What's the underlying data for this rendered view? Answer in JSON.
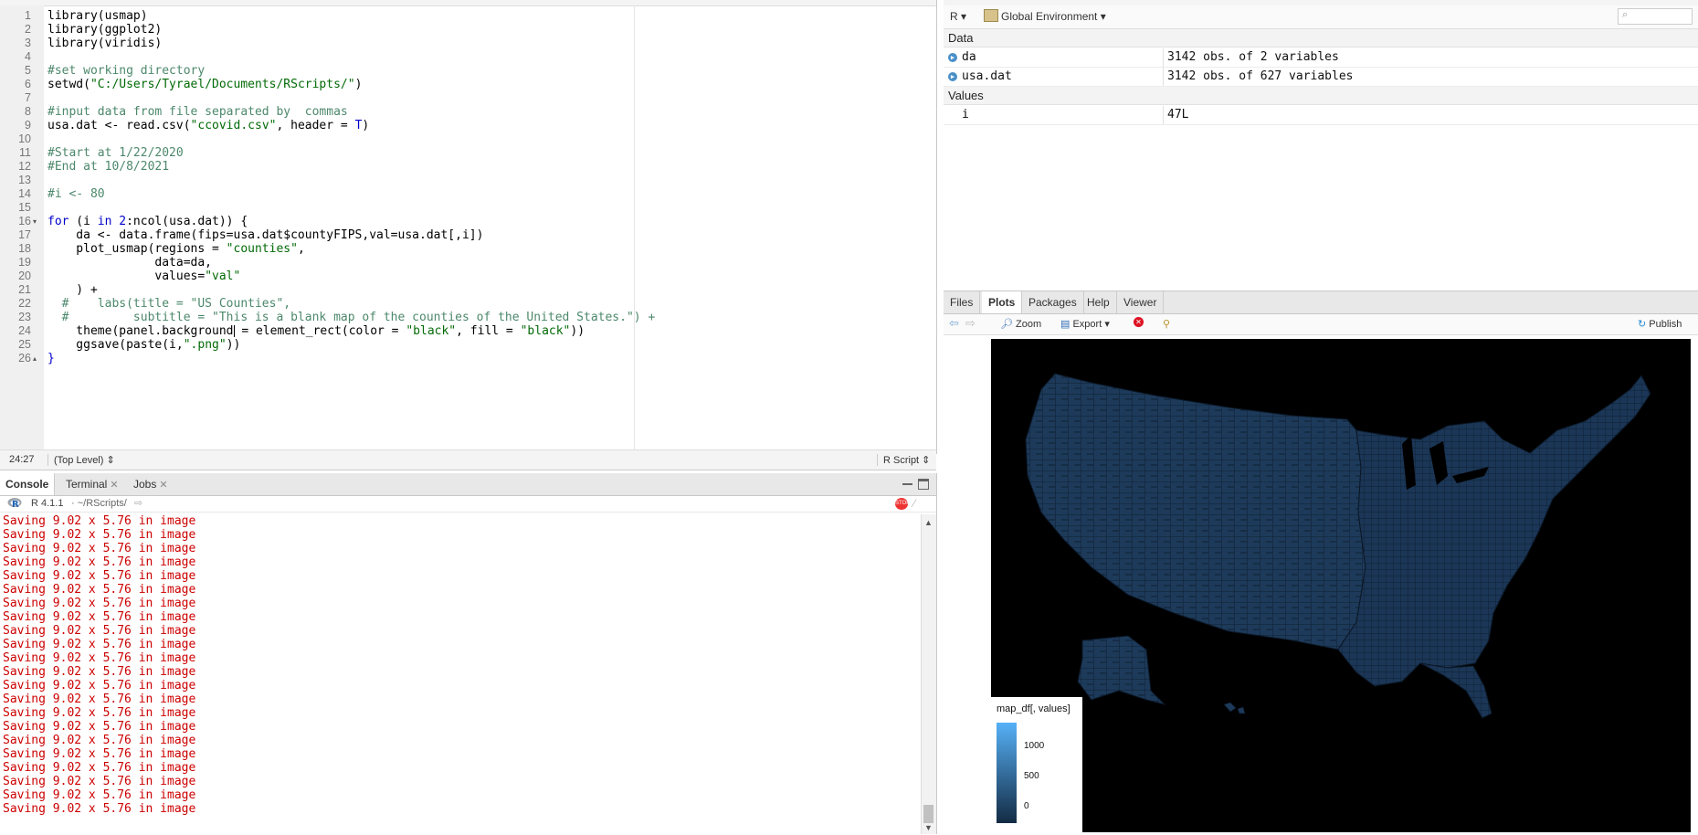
{
  "editor": {
    "lines": [
      {
        "n": "1",
        "fold": "",
        "tokens": [
          {
            "c": "plain",
            "t": "library(usmap)"
          }
        ]
      },
      {
        "n": "2",
        "fold": "",
        "tokens": [
          {
            "c": "plain",
            "t": "library(ggplot2)"
          }
        ]
      },
      {
        "n": "3",
        "fold": "",
        "tokens": [
          {
            "c": "plain",
            "t": "library(viridis)"
          }
        ]
      },
      {
        "n": "4",
        "fold": "",
        "tokens": []
      },
      {
        "n": "5",
        "fold": "",
        "tokens": [
          {
            "c": "cmt",
            "t": "#set working directory"
          }
        ]
      },
      {
        "n": "6",
        "fold": "",
        "tokens": [
          {
            "c": "plain",
            "t": "setwd("
          },
          {
            "c": "str",
            "t": "\"C:/Users/Tyrael/Documents/RScripts/\""
          },
          {
            "c": "plain",
            "t": ")"
          }
        ]
      },
      {
        "n": "7",
        "fold": "",
        "tokens": []
      },
      {
        "n": "8",
        "fold": "",
        "tokens": [
          {
            "c": "cmt",
            "t": "#input data from file separated by  commas"
          }
        ]
      },
      {
        "n": "9",
        "fold": "",
        "tokens": [
          {
            "c": "plain",
            "t": "usa.dat <- read.csv("
          },
          {
            "c": "str",
            "t": "\"ccovid.csv\""
          },
          {
            "c": "plain",
            "t": ", header = "
          },
          {
            "c": "kw",
            "t": "T"
          },
          {
            "c": "plain",
            "t": ")"
          }
        ]
      },
      {
        "n": "10",
        "fold": "",
        "tokens": []
      },
      {
        "n": "11",
        "fold": "",
        "tokens": [
          {
            "c": "cmt",
            "t": "#Start at 1/22/2020"
          }
        ]
      },
      {
        "n": "12",
        "fold": "",
        "tokens": [
          {
            "c": "cmt",
            "t": "#End at 10/8/2021"
          }
        ]
      },
      {
        "n": "13",
        "fold": "",
        "tokens": []
      },
      {
        "n": "14",
        "fold": "",
        "tokens": [
          {
            "c": "cmt",
            "t": "#i <- 80"
          }
        ]
      },
      {
        "n": "15",
        "fold": "",
        "tokens": []
      },
      {
        "n": "16",
        "fold": "▾",
        "tokens": [
          {
            "c": "kw",
            "t": "for"
          },
          {
            "c": "plain",
            "t": " (i "
          },
          {
            "c": "kw",
            "t": "in"
          },
          {
            "c": "plain",
            "t": " "
          },
          {
            "c": "num",
            "t": "2"
          },
          {
            "c": "plain",
            "t": ":ncol(usa.dat)) {"
          }
        ]
      },
      {
        "n": "17",
        "fold": "",
        "tokens": [
          {
            "c": "plain",
            "t": "    da <- data.frame(fips=usa.dat$countyFIPS,val=usa.dat[,i])"
          }
        ]
      },
      {
        "n": "18",
        "fold": "",
        "tokens": [
          {
            "c": "plain",
            "t": "    plot_usmap(regions = "
          },
          {
            "c": "str",
            "t": "\"counties\""
          },
          {
            "c": "plain",
            "t": ","
          }
        ]
      },
      {
        "n": "19",
        "fold": "",
        "tokens": [
          {
            "c": "plain",
            "t": "               data=da,"
          }
        ]
      },
      {
        "n": "20",
        "fold": "",
        "tokens": [
          {
            "c": "plain",
            "t": "               values="
          },
          {
            "c": "str",
            "t": "\"val\""
          }
        ]
      },
      {
        "n": "21",
        "fold": "",
        "tokens": [
          {
            "c": "plain",
            "t": "    ) +"
          }
        ]
      },
      {
        "n": "22",
        "fold": "",
        "tokens": [
          {
            "c": "cmt",
            "t": "  #    labs(title = \"US Counties\","
          }
        ]
      },
      {
        "n": "23",
        "fold": "",
        "tokens": [
          {
            "c": "cmt",
            "t": "  #         subtitle = \"This is a blank map of the counties of the United States.\") +"
          }
        ]
      },
      {
        "n": "24",
        "fold": "",
        "tokens": [
          {
            "c": "plain",
            "t": "    theme(panel.background"
          },
          {
            "c": "cursor",
            "t": ""
          },
          {
            "c": "plain",
            "t": " = element_rect(color = "
          },
          {
            "c": "str",
            "t": "\"black\""
          },
          {
            "c": "plain",
            "t": ", fill = "
          },
          {
            "c": "str",
            "t": "\"black\""
          },
          {
            "c": "plain",
            "t": "))"
          }
        ]
      },
      {
        "n": "25",
        "fold": "",
        "tokens": [
          {
            "c": "plain",
            "t": "    ggsave(paste(i,"
          },
          {
            "c": "str",
            "t": "\".png\""
          },
          {
            "c": "plain",
            "t": "))"
          }
        ]
      },
      {
        "n": "26",
        "fold": "▴",
        "tokens": [
          {
            "c": "kw",
            "t": "}"
          }
        ]
      }
    ],
    "status": {
      "position": "24:27",
      "scope": "(Top Level) ⇕",
      "filetype": "R Script ⇕"
    }
  },
  "console": {
    "tabs": [
      {
        "label": "Console",
        "closable": false
      },
      {
        "label": "Terminal",
        "closable": true
      },
      {
        "label": "Jobs",
        "closable": true
      }
    ],
    "r_version": "R 4.1.1",
    "path": "· ~/RScripts/",
    "output_line": "Saving 9.02 x 5.76 in image",
    "output_count": 22
  },
  "environment": {
    "scope_label": "R ▾",
    "env_label": "Global Environment ▾",
    "sections": [
      {
        "title": "Data",
        "rows": [
          {
            "name": "da",
            "value": "3142 obs. of 2 variables",
            "expandable": true
          },
          {
            "name": "usa.dat",
            "value": "3142 obs. of 627 variables",
            "expandable": true
          }
        ]
      },
      {
        "title": "Values",
        "rows": [
          {
            "name": "i",
            "value": "47L",
            "expandable": false
          }
        ]
      }
    ]
  },
  "plots": {
    "tabs": [
      "Files",
      "Plots",
      "Packages",
      "Help",
      "Viewer"
    ],
    "active_tab": "Plots",
    "toolbar": {
      "zoom": "Zoom",
      "export": "Export ▾",
      "publish": "Publish"
    },
    "legend": {
      "title": "map_df[, values]",
      "ticks": [
        "1000",
        "500",
        "0"
      ],
      "colors": {
        "high": "#56b1f7",
        "low": "#132b43"
      }
    }
  }
}
